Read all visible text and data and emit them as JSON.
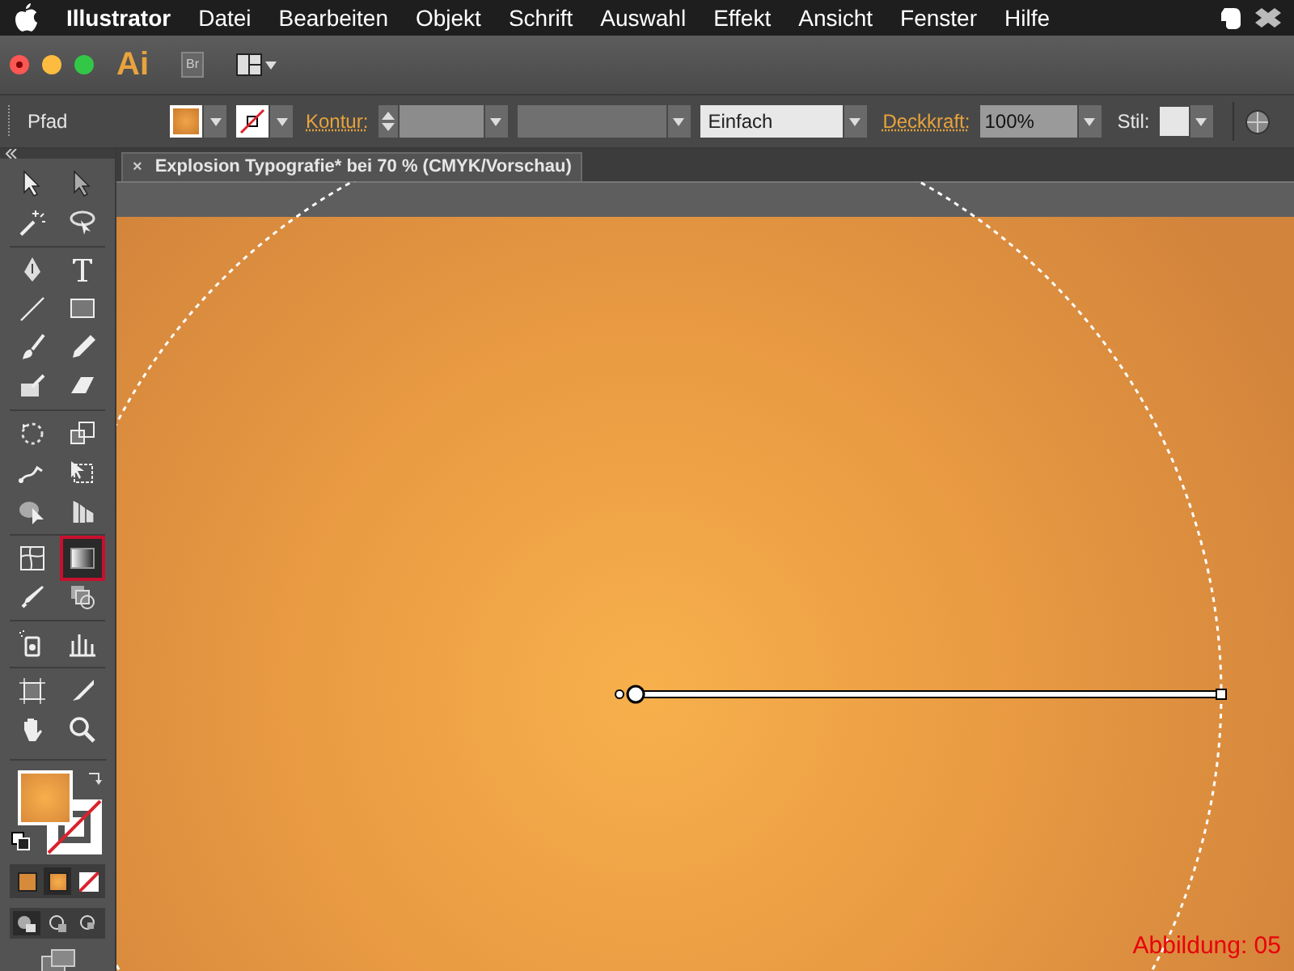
{
  "menu_bar": {
    "app": "Illustrator",
    "items": [
      "Datei",
      "Bearbeiten",
      "Objekt",
      "Schrift",
      "Auswahl",
      "Effekt",
      "Ansicht",
      "Fenster",
      "Hilfe"
    ]
  },
  "app_bar": {
    "logo": "Ai",
    "bridge": "Br"
  },
  "control_bar": {
    "selection": "Pfad",
    "stroke_label": "Kontur:",
    "stroke_profile": "Einfach",
    "opacity_label": "Deckkraft:",
    "opacity_value": "100%",
    "style_label": "Stil:"
  },
  "document_tab": {
    "close": "×",
    "title": "Explosion Typografie* bei 70 % (CMYK/Vorschau)"
  },
  "tools": [
    {
      "selected": false
    },
    {
      "selected": false
    },
    {
      "selected": false
    },
    {
      "selected": false
    },
    {
      "selected": false
    },
    {
      "selected": false
    },
    {
      "selected": false
    },
    {
      "selected": false
    },
    {
      "selected": false
    },
    {
      "selected": false
    },
    {
      "selected": false
    },
    {
      "selected": false
    },
    {
      "selected": false
    },
    {
      "selected": false
    },
    {
      "selected": false
    },
    {
      "selected": false
    },
    {
      "selected": false
    },
    {
      "selected": false
    },
    {
      "selected": false
    },
    {
      "selected": true
    },
    {
      "selected": false
    },
    {
      "selected": false
    },
    {
      "selected": false
    },
    {
      "selected": false
    },
    {
      "selected": false
    },
    {
      "selected": false
    },
    {
      "selected": false
    },
    {
      "selected": false
    }
  ],
  "caption": "Abbildung: 05"
}
